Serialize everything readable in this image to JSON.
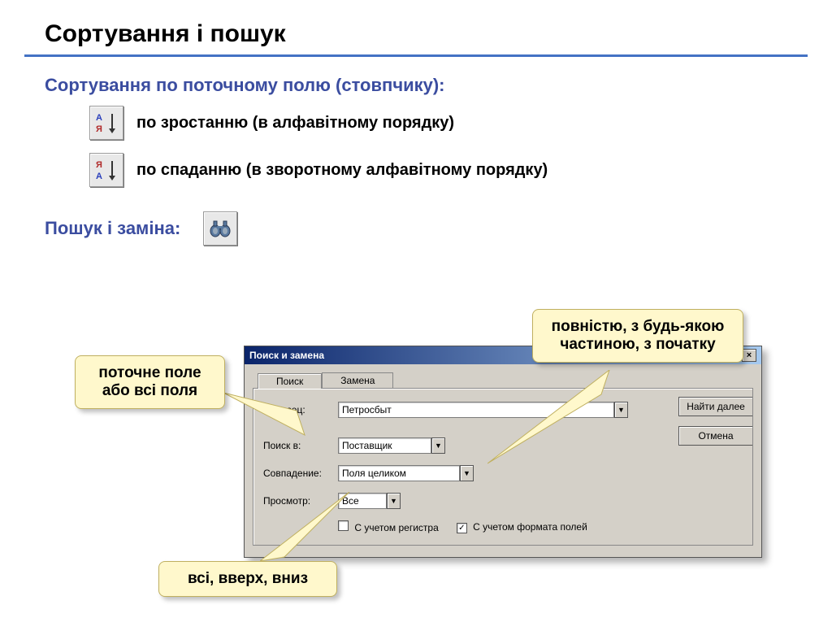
{
  "page": {
    "title": "Сортування і пошук",
    "section_sort": "Сортування по поточному полю (стовпчику):",
    "sort_asc": "по зростанню (в алфавітному порядку)",
    "sort_desc": "по спаданню (в зворотному алфавітному порядку)",
    "section_search": "Пошук і заміна:"
  },
  "callouts": {
    "current_field": "поточне поле або всі поля",
    "match_type": "повністю, з будь-якою частиною, з початку",
    "direction": "всі, вверх, вниз"
  },
  "dialog": {
    "title": "Поиск и замена",
    "tab_search": "Поиск",
    "tab_replace": "Замена",
    "label_sample": "Образец:",
    "sample_value": "Петросбыт",
    "label_search_in": "Поиск в:",
    "search_in_value": "Поставщик",
    "label_match": "Совпадение:",
    "match_value": "Поля целиком",
    "label_view": "Просмотр:",
    "view_value": "Все",
    "cb_case": "С учетом регистра",
    "cb_format": "С учетом формата полей",
    "btn_find_next": "Найти далее",
    "btn_cancel": "Отмена"
  }
}
